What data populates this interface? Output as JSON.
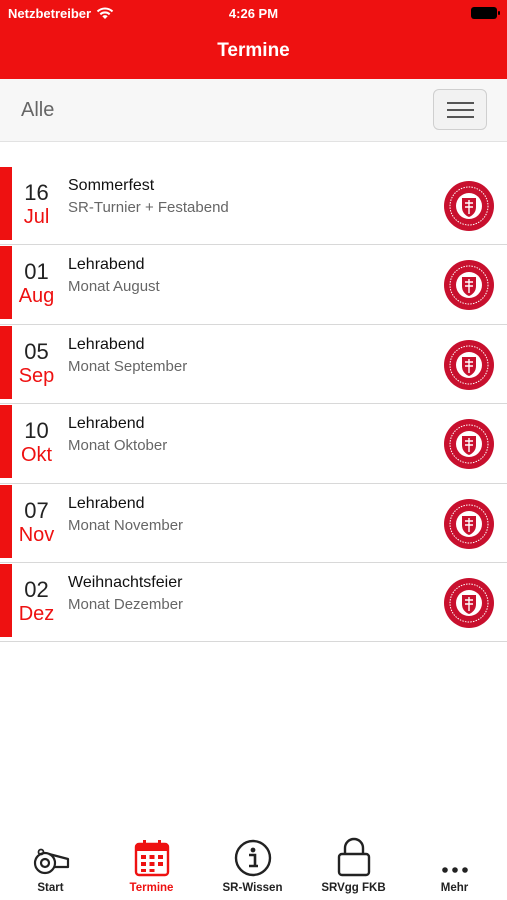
{
  "status_bar": {
    "carrier": "Netzbetreiber",
    "time": "4:26 PM"
  },
  "header": {
    "title": "Termine"
  },
  "filter": {
    "label": "Alle"
  },
  "events": [
    {
      "day": "16",
      "month": "Jul",
      "title": "Sommerfest",
      "subtitle": "SR-Turnier + Festabend"
    },
    {
      "day": "01",
      "month": "Aug",
      "title": "Lehrabend",
      "subtitle": "Monat August"
    },
    {
      "day": "05",
      "month": "Sep",
      "title": "Lehrabend",
      "subtitle": "Monat September"
    },
    {
      "day": "10",
      "month": "Okt",
      "title": "Lehrabend",
      "subtitle": "Monat Oktober"
    },
    {
      "day": "07",
      "month": "Nov",
      "title": "Lehrabend",
      "subtitle": "Monat November"
    },
    {
      "day": "02",
      "month": "Dez",
      "title": "Weihnachtsfeier",
      "subtitle": "Monat Dezember"
    }
  ],
  "tabbar": {
    "tabs": [
      {
        "label": "Start",
        "icon": "whistle-icon"
      },
      {
        "label": "Termine",
        "icon": "calendar-icon",
        "active": true
      },
      {
        "label": "SR-Wissen",
        "icon": "info-icon"
      },
      {
        "label": "SRVgg FKB",
        "icon": "lock-icon"
      },
      {
        "label": "Mehr",
        "icon": "more-icon"
      }
    ]
  },
  "colors": {
    "accent": "#ee1111",
    "logo": "#c8102e"
  }
}
